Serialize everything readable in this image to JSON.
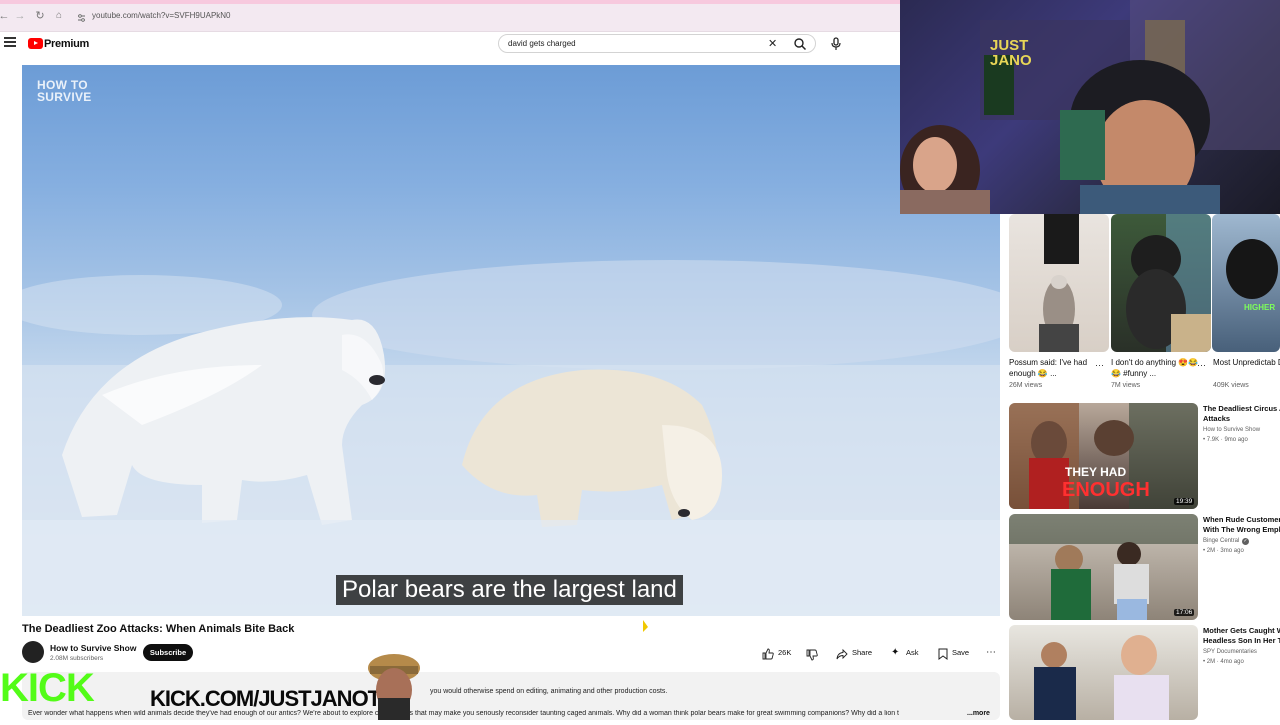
{
  "browser": {
    "url": "youtube.com/watch?v=SVFH9UAPkN0",
    "back_icon": "arrow-left-icon",
    "forward_icon": "arrow-right-icon",
    "reload_icon": "reload-icon",
    "home_icon": "home-icon"
  },
  "header": {
    "logo_text": "Premium",
    "search": {
      "value": "david gets charged"
    }
  },
  "video": {
    "watermark_line1": "HOW TO",
    "watermark_line2": "SURVIVE",
    "subtitle": "Polar bears are the largest land",
    "title": "The Deadliest Zoo Attacks: When Animals Bite Back"
  },
  "channel": {
    "name": "How to Survive Show",
    "subscribers": "2.08M subscribers",
    "subscribe_label": "Subscribe"
  },
  "actions": {
    "likes": "26K",
    "share_label": "Share",
    "ask_label": "Ask",
    "save_label": "Save"
  },
  "description": {
    "line1": "you would otherwise spend on editing, animating and other production costs.",
    "line2": "Ever wonder what happens when wild animals decide they've had enough of our antics? We're about to explore chilling tales that may make you seriously reconsider taunting caged animals. Why did a woman think polar bears make for great swimming companions? Why did a lion t",
    "more_label": "...more"
  },
  "overlay": {
    "kick_logo": "KICK",
    "kick_url": "KICK.COM/JUSTJANOTV",
    "webcam_sign_line1": "JUST",
    "webcam_sign_line2": "JANO"
  },
  "shorts": [
    {
      "title": "Possum said: I've had enough 😂 ...",
      "views": "26M views"
    },
    {
      "title": "I don't do anything 😍😂😂 #funny ...",
      "views": "7M views"
    },
    {
      "title": "Most Unpredictab Dog Breeds 😱 ...",
      "views": "409K views"
    }
  ],
  "recommended": [
    {
      "title_line1": "The Deadliest Circus An",
      "title_line2": "Attacks",
      "channel": "How to Survive Show",
      "meta": "• 7.9K · 9mo ago",
      "duration": "19:39",
      "overlay_line1": "THEY HAD",
      "overlay_line2": "ENOUGH"
    },
    {
      "title_line1": "When Rude Customers",
      "title_line2": "With The Wrong Employ",
      "channel": "Binge Central",
      "meta": "• 2M · 3mo ago",
      "duration": "17:06"
    },
    {
      "title_line1": "Mother Gets Caught Wi",
      "title_line2": "Headless Son In Her T",
      "channel": "SPY Documentaries",
      "meta": "• 2M · 4mo ago",
      "duration": ""
    }
  ]
}
